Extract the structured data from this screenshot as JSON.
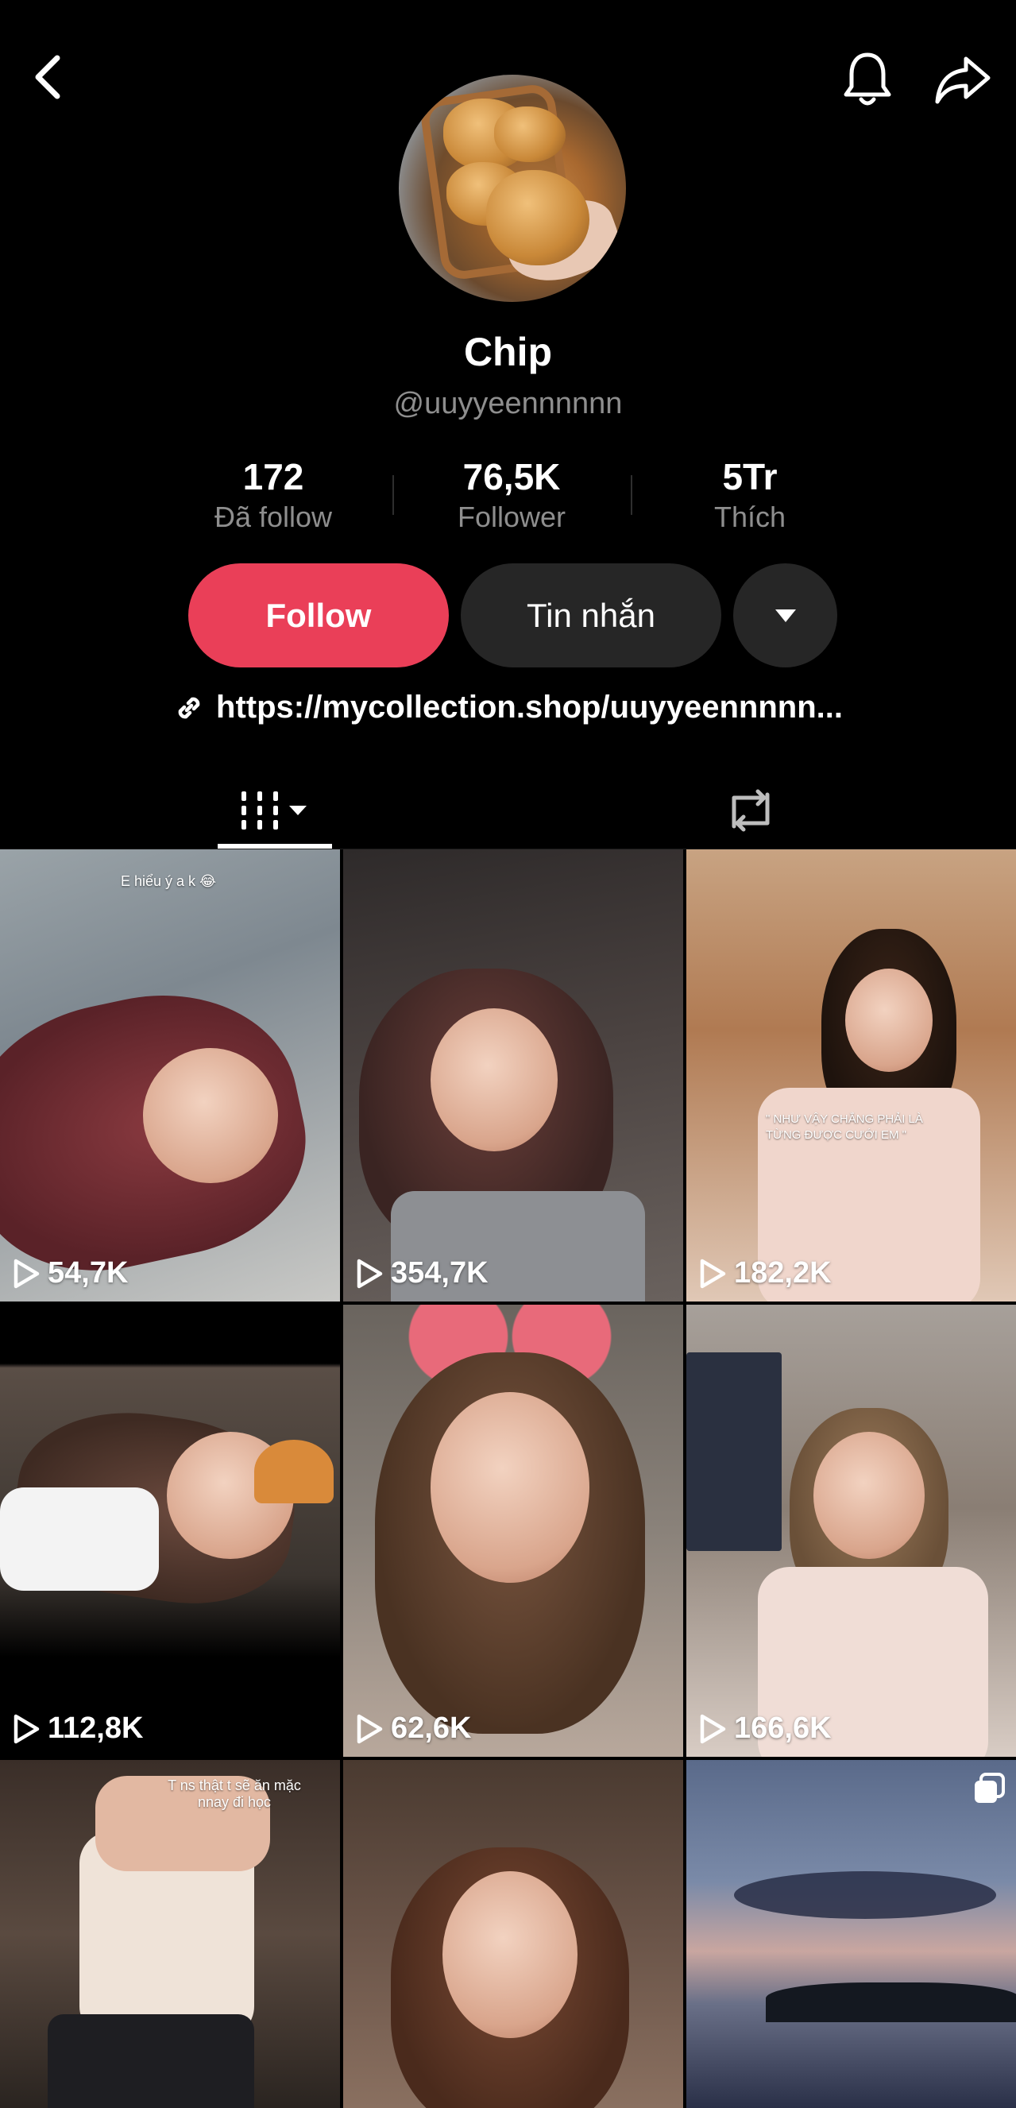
{
  "header": {
    "back_icon": "chevron-left-icon",
    "bell_icon": "bell-icon",
    "share_icon": "share-arrow-icon"
  },
  "profile": {
    "display_name": "Chip",
    "handle": "@uuyyeennnnnn",
    "stats": {
      "following": {
        "value": "172",
        "label": "Đã follow"
      },
      "followers": {
        "value": "76,5K",
        "label": "Follower"
      },
      "likes": {
        "value": "5Tr",
        "label": "Thích"
      }
    },
    "buttons": {
      "follow": "Follow",
      "message": "Tin nhắn"
    },
    "bio_link": "https://mycollection.shop/uuyyeennnnn..."
  },
  "tabs": {
    "videos_icon": "grid-icon",
    "reposts_icon": "repost-icon"
  },
  "videos": [
    {
      "views": "54,7K",
      "caption": "E hiểu ý a k 😂"
    },
    {
      "views": "354,7K",
      "caption": ""
    },
    {
      "views": "182,2K",
      "caption": "\" NHƯ VẬY CHẲNG PHẢI LÀ TỪNG ĐƯỢC CƯỚI EM \""
    },
    {
      "views": "112,8K",
      "caption": ""
    },
    {
      "views": "62,6K",
      "caption": ""
    },
    {
      "views": "166,6K",
      "caption": ""
    },
    {
      "views": "",
      "caption": "T ns thật t sẽ ăn mặc nnay đi học"
    },
    {
      "views": "",
      "caption": ""
    },
    {
      "views": "",
      "caption": ""
    }
  ],
  "colors": {
    "background": "#000000",
    "follow_button": "#ea3f58",
    "secondary_button": "#262626",
    "muted_text": "#8e8e8e"
  }
}
